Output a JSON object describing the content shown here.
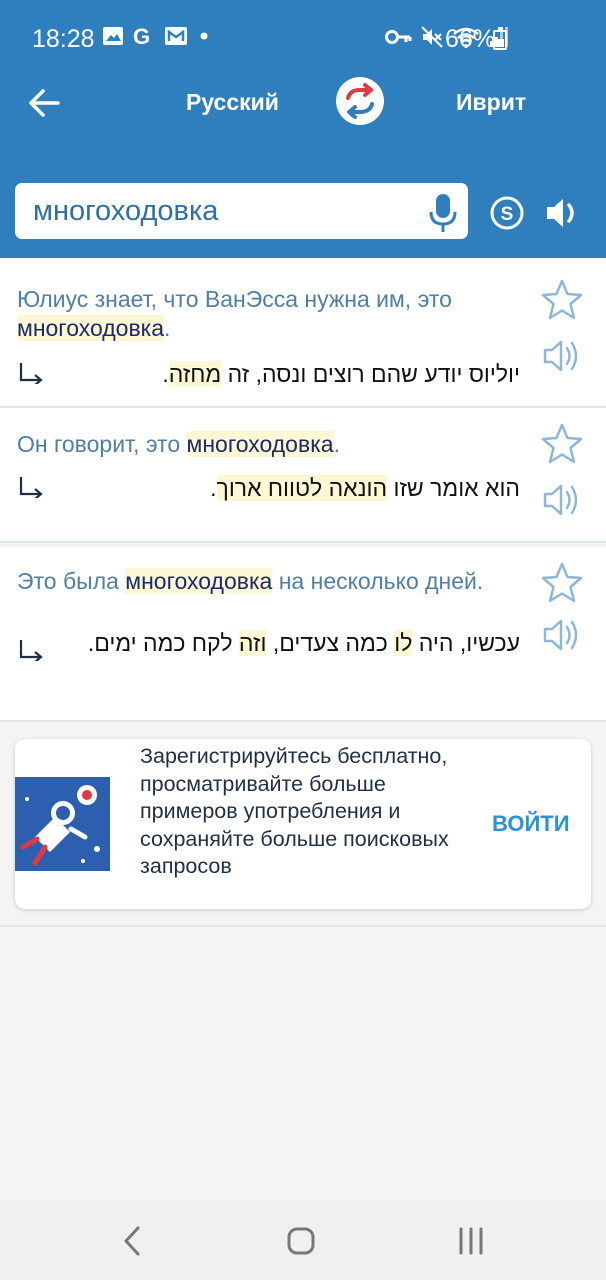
{
  "status_bar": {
    "time": "18:28",
    "left_icons": [
      "image-icon",
      "google-icon",
      "mail-icon",
      "dot-icon"
    ],
    "right_icons": [
      "key-icon",
      "mute-icon",
      "wifi-icon",
      "signal-icon"
    ],
    "battery": "66%"
  },
  "toolbar": {
    "source_language": "Русский",
    "target_language": "Иврит"
  },
  "search": {
    "query": "многоходовка"
  },
  "results": [
    {
      "src_before": "Юлиус знает, что ВанЭсса нужна им, это ",
      "src_highlight": "многоходовка",
      "src_after": ".",
      "tr_before": "יוליוס יודע שהם רוצים ונסה, זה ",
      "tr_highlight": "מחזה",
      "tr_after": "."
    },
    {
      "src_before": "Он говорит, это ",
      "src_highlight": "многоходовка",
      "src_after": ".",
      "tr_before": "הוא אומר שזו ",
      "tr_highlight": "הונאה לטווח ארוך",
      "tr_after": "."
    },
    {
      "src_before": "Это была ",
      "src_highlight": "многоходовка",
      "src_after": " на несколько дней.",
      "tr_before": "עכשיו, היה ",
      "tr_highlight": "לו",
      "tr_middle": " כמה צעדים, ",
      "tr_highlight2": "וזה",
      "tr_after": " לקח כמה ימים."
    }
  ],
  "promo": {
    "text": "Зарегистрируйтесь бесплатно, просматривайте больше примеров употребления и сохраняйте больше поисковых запросов",
    "login_label": "ВОЙТИ",
    "image_bg": "#2d5fb0"
  },
  "colors": {
    "header": "#2f7fbe",
    "source_text": "#4f7fa8",
    "highlight": "#fdf7d4",
    "link": "#2a93d5"
  }
}
